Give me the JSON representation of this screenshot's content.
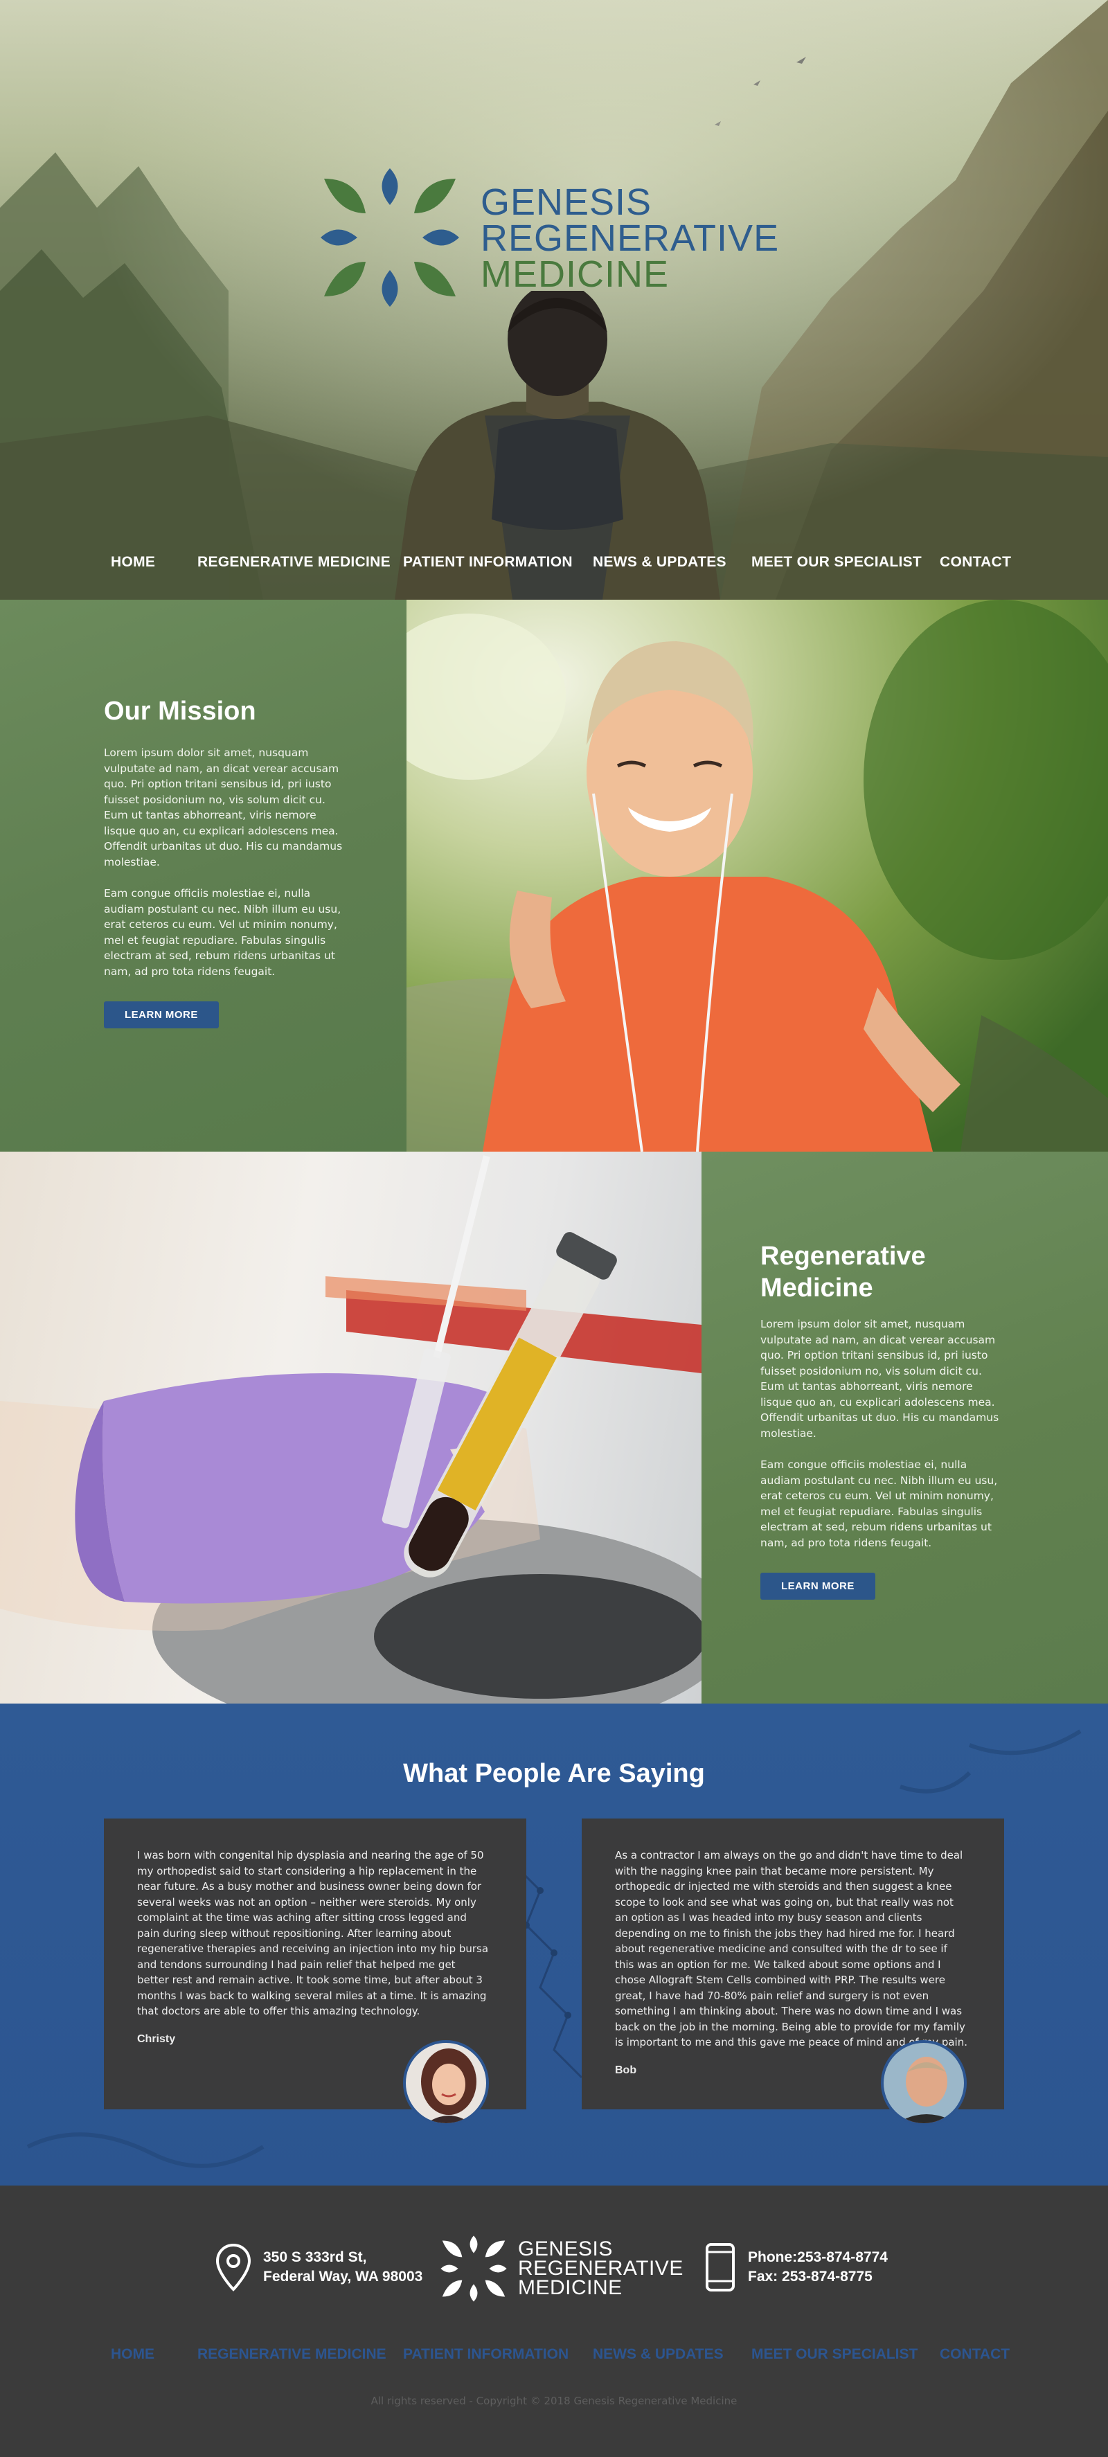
{
  "brand": {
    "line1": "GENESIS",
    "line2": "REGENERATIVE",
    "line3": "MEDICINE",
    "colors": {
      "blue": "#2e5d8e",
      "green": "#4a7a3e",
      "panel_green": "#61814f",
      "testimonial_blue": "#2c5590",
      "footer": "#3b3b3b"
    }
  },
  "nav": {
    "items": [
      "HOME",
      "REGENERATIVE MEDICINE",
      "PATIENT INFORMATION",
      "NEWS & UPDATES",
      "MEET OUR SPECIALIST",
      "CONTACT"
    ]
  },
  "mission": {
    "title": "Our Mission",
    "p1": "Lorem ipsum dolor sit amet, nusquam vulputate ad nam, an dicat verear accusam quo. Pri option tritani sensibus id, pri iusto fuisset posidonium no, vis solum dicit cu. Eum ut tantas abhorreant, viris nemore lisque quo an, cu explicari adolescens mea. Offendit urbanitas ut duo. His cu mandamus molestiae.",
    "p2": "Eam congue officiis molestiae ei, nulla audiam postulant cu nec. Nibh illum eu usu, erat ceteros cu eum. Vel ut minim nonumy, mel et feugiat repudiare. Fabulas singulis electram at sed, rebum ridens urbanitas ut nam, ad pro tota ridens feugait.",
    "button": "LEARN MORE"
  },
  "regen": {
    "title_line1": "Regenerative",
    "title_line2": "Medicine",
    "p1": "Lorem ipsum dolor sit amet, nusquam vulputate ad nam, an dicat verear accusam quo. Pri option tritani sensibus id, pri iusto fuisset posidonium no, vis solum dicit cu. Eum ut tantas abhorreant, viris nemore lisque quo an, cu explicari adolescens mea. Offendit urbanitas ut duo. His cu mandamus molestiae.",
    "p2": "Eam congue officiis molestiae ei, nulla audiam postulant cu nec. Nibh illum eu usu, erat ceteros cu eum. Vel ut minim nonumy, mel et feugiat repudiare. Fabulas singulis electram at sed, rebum ridens urbanitas ut nam, ad pro tota ridens feugait.",
    "button": "LEARN MORE"
  },
  "testimonials": {
    "title": "What People Are Saying",
    "items": [
      {
        "quote": "I was born with congenital hip dysplasia and nearing the age of 50 my orthopedist said to start considering a hip replacement in the near future. As a busy mother and business owner being down for several weeks was not an option – neither were steroids. My only complaint at the time was aching after sitting cross legged and pain during sleep without repositioning. After learning about regenerative therapies and receiving an injection into my hip bursa and tendons surrounding I had pain relief that helped me get better rest and remain active. It took some time, but after about 3 months I was back to walking several miles at a time. It is amazing that doctors are able to offer this amazing technology.",
        "author": "Christy"
      },
      {
        "quote": "As a contractor I am always on the go and didn't have time to deal with the nagging knee pain that became more persistent. My orthopedic dr injected me with steroids and then suggest a knee scope to look and see what was going on, but that really was not an option as I was headed into my busy season and clients depending on me to finish the jobs they had hired me for. I heard about regenerative medicine and consulted with the dr to see if this was an option for me. We talked about some options and I chose Allograft Stem Cells combined with PRP. The results were great, I have had 70-80% pain relief and surgery is not even something I am thinking about. There was no down time and I was back on the job in the morning. Being able to provide for my family is important to me and this gave me peace of mind and of my pain.",
        "author": "Bob"
      }
    ]
  },
  "footer": {
    "address_line1": "350 S 333rd St,",
    "address_line2": "Federal Way, WA 98003",
    "phone": "Phone:253-874-8774",
    "fax": "Fax: 253-874-8775",
    "logo_line1": "GENESIS",
    "logo_line2": "REGENERATIVE",
    "logo_line3": "MEDICINE",
    "copyright": "All rights reserved - Copyright © 2018 Genesis Regenerative Medicine"
  },
  "icons": [
    "location-pin-icon",
    "phone-icon",
    "logo-mark-icon"
  ]
}
